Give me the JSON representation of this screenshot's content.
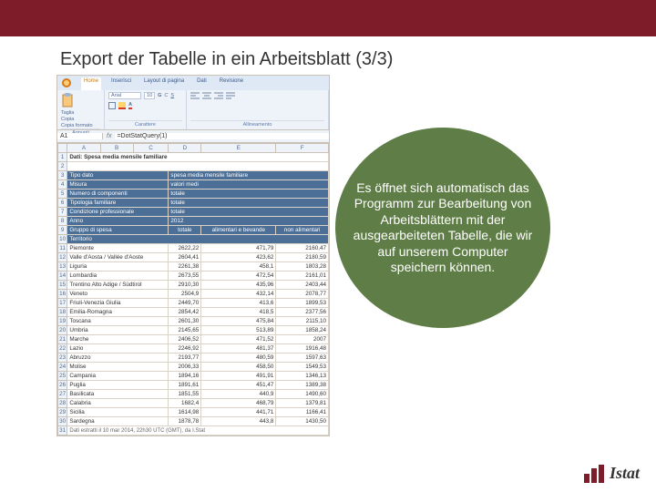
{
  "slide": {
    "title": "Export der Tabelle in ein Arbeitsblatt (3/3)"
  },
  "callout": {
    "text": "Es öffnet sich automatisch das Programm zur Bearbeitung von Arbeitsblättern mit der ausgearbeiteten Tabelle, die wir auf unserem Computer speichern können."
  },
  "excel": {
    "tabs": {
      "home": "Home",
      "insert": "Inserisci",
      "layout": "Layout di pagina",
      "data": "Dati",
      "review": "Revisione"
    },
    "ribbon_groups": {
      "clipboard": "Appunti",
      "font": "Carattere",
      "alignment": "Allineamento"
    },
    "clipboard": {
      "cut": "Taglia",
      "copy": "Copia",
      "format": "Copia formato"
    },
    "font_sample": "Arial",
    "font_size": "10",
    "cell_name": "A1",
    "fx_label": "fx",
    "formula": "=DotStatQuery(1)",
    "col_headers": [
      "A",
      "B",
      "C",
      "D",
      "E",
      "F"
    ],
    "row_nums": [
      "1",
      "2",
      "3",
      "4",
      "5",
      "6",
      "7",
      "8",
      "9",
      "10",
      "11",
      "12",
      "13",
      "14",
      "15",
      "16",
      "17",
      "18",
      "19",
      "20",
      "21",
      "22",
      "23",
      "24",
      "25",
      "26",
      "27",
      "28",
      "29",
      "30",
      "31"
    ],
    "data_title": "Dati: Spesa media mensile familiare",
    "meta": {
      "tipo_dato_lbl": "Tipo dato",
      "tipo_dato_val": "spesa media mensile familiare",
      "misura_lbl": "Misura",
      "misura_val": "valori medi",
      "componenti_lbl": "Numero di componenti",
      "componenti_val": "totale",
      "tipologia_lbl": "Tipologia familiare",
      "tipologia_val": "totale",
      "condizione_lbl": "Condizione professionale",
      "condizione_val": "totale",
      "anno_lbl": "Anno",
      "anno_val": "2012"
    },
    "group_label": "Gruppo di spesa",
    "col_categories": [
      "totale",
      "alimentari e bevande",
      "non alimentari"
    ],
    "territorio_lbl": "Territorio",
    "rows": [
      {
        "name": "Piemonte",
        "v": [
          "2622,22",
          "471,79",
          "2160,47"
        ]
      },
      {
        "name": "Valle d'Aosta / Vallée d'Aoste",
        "v": [
          "2604,41",
          "423,62",
          "2180,59"
        ]
      },
      {
        "name": "Liguria",
        "v": [
          "2261,38",
          "458,1",
          "1803,28"
        ]
      },
      {
        "name": "Lombardia",
        "v": [
          "2673,55",
          "472,54",
          "2161,01"
        ]
      },
      {
        "name": "Trentino Alto Adige / Südtirol",
        "v": [
          "2910,30",
          "435,96",
          "2403,44"
        ]
      },
      {
        "name": "Veneto",
        "v": [
          "2504,9",
          "432,14",
          "2078,77"
        ]
      },
      {
        "name": "Friuli-Venezia Giulia",
        "v": [
          "2449,70",
          "413,6",
          "1899,53"
        ]
      },
      {
        "name": "Emilia-Romagna",
        "v": [
          "2854,42",
          "418,5",
          "2377,56"
        ]
      },
      {
        "name": "Toscana",
        "v": [
          "2601,30",
          "475,84",
          "2115,10"
        ]
      },
      {
        "name": "Umbria",
        "v": [
          "2145,65",
          "513,89",
          "1858,24"
        ]
      },
      {
        "name": "Marche",
        "v": [
          "2406,52",
          "471,52",
          "2007"
        ]
      },
      {
        "name": "Lazio",
        "v": [
          "2246,92",
          "481,37",
          "1916,48"
        ]
      },
      {
        "name": "Abruzzo",
        "v": [
          "2193,77",
          "480,59",
          "1597,63"
        ]
      },
      {
        "name": "Molise",
        "v": [
          "2006,33",
          "458,50",
          "1549,53"
        ]
      },
      {
        "name": "Campania",
        "v": [
          "1894,16",
          "491,91",
          "1346,13"
        ]
      },
      {
        "name": "Puglia",
        "v": [
          "1891,61",
          "451,47",
          "1389,38"
        ]
      },
      {
        "name": "Basilicata",
        "v": [
          "1851,55",
          "440,9",
          "1490,60"
        ]
      },
      {
        "name": "Calabria",
        "v": [
          "1682,4",
          "468,79",
          "1379,81"
        ]
      },
      {
        "name": "Sicilia",
        "v": [
          "1614,98",
          "441,71",
          "1166,41"
        ]
      },
      {
        "name": "Sardegna",
        "v": [
          "1878,78",
          "443,8",
          "1430,50"
        ]
      }
    ],
    "footnote": "Dati estratti il 10 mar 2014, 22h30 UTC (GMT), da I.Stat"
  },
  "brand": {
    "name": "Istat"
  }
}
